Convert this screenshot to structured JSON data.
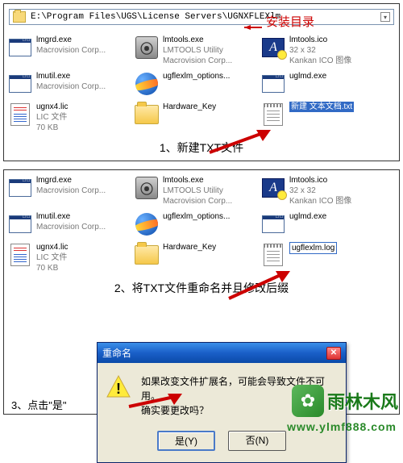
{
  "pathbar": {
    "path": "E:\\Program Files\\UGS\\License Servers\\UGNXFLEXlm"
  },
  "annot": {
    "installDir": "安装目录",
    "step1": "1、新建TXT文件",
    "step2": "2、将TXT文件重命名并且修改后缀",
    "step3": "3、点击\"是\""
  },
  "files1": [
    {
      "name": "lmgrd.exe",
      "line2": "Macrovision Corp...",
      "icon": "exe"
    },
    {
      "name": "lmtools.exe",
      "line2": "LMTOOLS Utility",
      "line3": "Macrovision Corp...",
      "icon": "ltool"
    },
    {
      "name": "lmtools.ico",
      "line2": "32 x 32",
      "line3": "Kankan ICO 图像",
      "icon": "ico-a"
    },
    {
      "name": "lmutil.exe",
      "line2": "Macrovision Corp...",
      "icon": "exe"
    },
    {
      "name": "ugflexlm_options...",
      "icon": "globe"
    },
    {
      "name": "uglmd.exe",
      "icon": "exe"
    },
    {
      "name": "ugnx4.lic",
      "line2": "LIC 文件",
      "line3": "70 KB",
      "icon": "lic"
    },
    {
      "name": "Hardware_Key",
      "icon": "folder"
    },
    {
      "name": "新建 文本文档.txt",
      "icon": "txt",
      "sel": true
    }
  ],
  "files2": [
    {
      "name": "lmgrd.exe",
      "line2": "Macrovision Corp...",
      "icon": "exe"
    },
    {
      "name": "lmtools.exe",
      "line2": "LMTOOLS Utility",
      "line3": "Macrovision Corp...",
      "icon": "ltool"
    },
    {
      "name": "lmtools.ico",
      "line2": "32 x 32",
      "line3": "Kankan ICO 图像",
      "icon": "ico-a"
    },
    {
      "name": "lmutil.exe",
      "line2": "Macrovision Corp...",
      "icon": "exe"
    },
    {
      "name": "ugflexlm_options...",
      "icon": "globe"
    },
    {
      "name": "uglmd.exe",
      "icon": "exe"
    },
    {
      "name": "ugnx4.lic",
      "line2": "LIC 文件",
      "line3": "70 KB",
      "icon": "lic"
    },
    {
      "name": "Hardware_Key",
      "icon": "folder"
    },
    {
      "name": "ugflexlm.log",
      "icon": "txt",
      "sel": true,
      "editing": true
    }
  ],
  "dialog": {
    "title": "重命名",
    "line1": "如果改变文件扩展名，可能会导致文件不可用。",
    "line2": "确实要更改吗？",
    "yes": "是(Y)",
    "no": "否(N)"
  },
  "brand": {
    "text": "雨林木风",
    "url": "www.ylmf888.com"
  }
}
